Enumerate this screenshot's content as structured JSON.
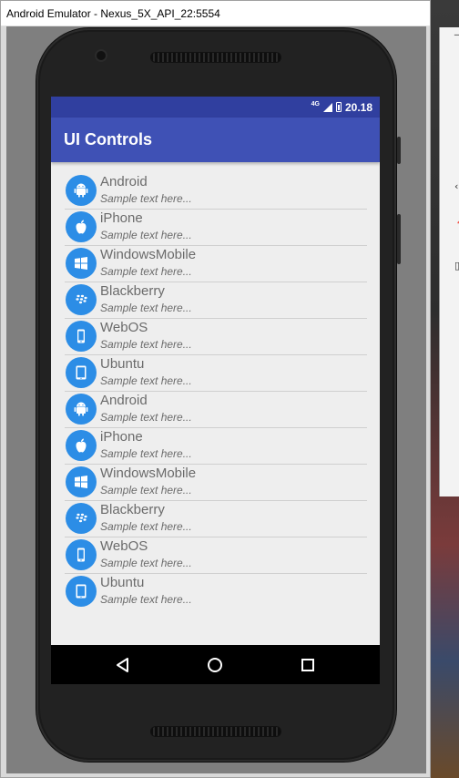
{
  "window": {
    "title": "Android Emulator - Nexus_5X_API_22:5554"
  },
  "status_bar": {
    "network": "4G",
    "time": "20.18"
  },
  "app_bar": {
    "title": "UI Controls"
  },
  "list": {
    "items": [
      {
        "title": "Android",
        "subtitle": "Sample text here...",
        "icon": "android-icon"
      },
      {
        "title": "iPhone",
        "subtitle": "Sample text here...",
        "icon": "apple-icon"
      },
      {
        "title": "WindowsMobile",
        "subtitle": "Sample text here...",
        "icon": "windows-icon"
      },
      {
        "title": "Blackberry",
        "subtitle": "Sample text here...",
        "icon": "blackberry-icon"
      },
      {
        "title": "WebOS",
        "subtitle": "Sample text here...",
        "icon": "phone-icon"
      },
      {
        "title": "Ubuntu",
        "subtitle": "Sample text here...",
        "icon": "tablet-icon"
      },
      {
        "title": "Android",
        "subtitle": "Sample text here...",
        "icon": "android-icon"
      },
      {
        "title": "iPhone",
        "subtitle": "Sample text here...",
        "icon": "apple-icon"
      },
      {
        "title": "WindowsMobile",
        "subtitle": "Sample text here...",
        "icon": "windows-icon"
      },
      {
        "title": "Blackberry",
        "subtitle": "Sample text here...",
        "icon": "blackberry-icon"
      },
      {
        "title": "WebOS",
        "subtitle": "Sample text here...",
        "icon": "phone-icon"
      },
      {
        "title": "Ubuntu",
        "subtitle": "Sample text here...",
        "icon": "tablet-icon"
      }
    ]
  },
  "nav_bar": {
    "buttons": [
      "back-icon",
      "home-icon",
      "recents-icon"
    ]
  },
  "colors": {
    "status_bar": "#303f9f",
    "app_bar": "#3f51b5",
    "icon_circle": "#2c8de6",
    "list_background": "#eeeeee"
  }
}
